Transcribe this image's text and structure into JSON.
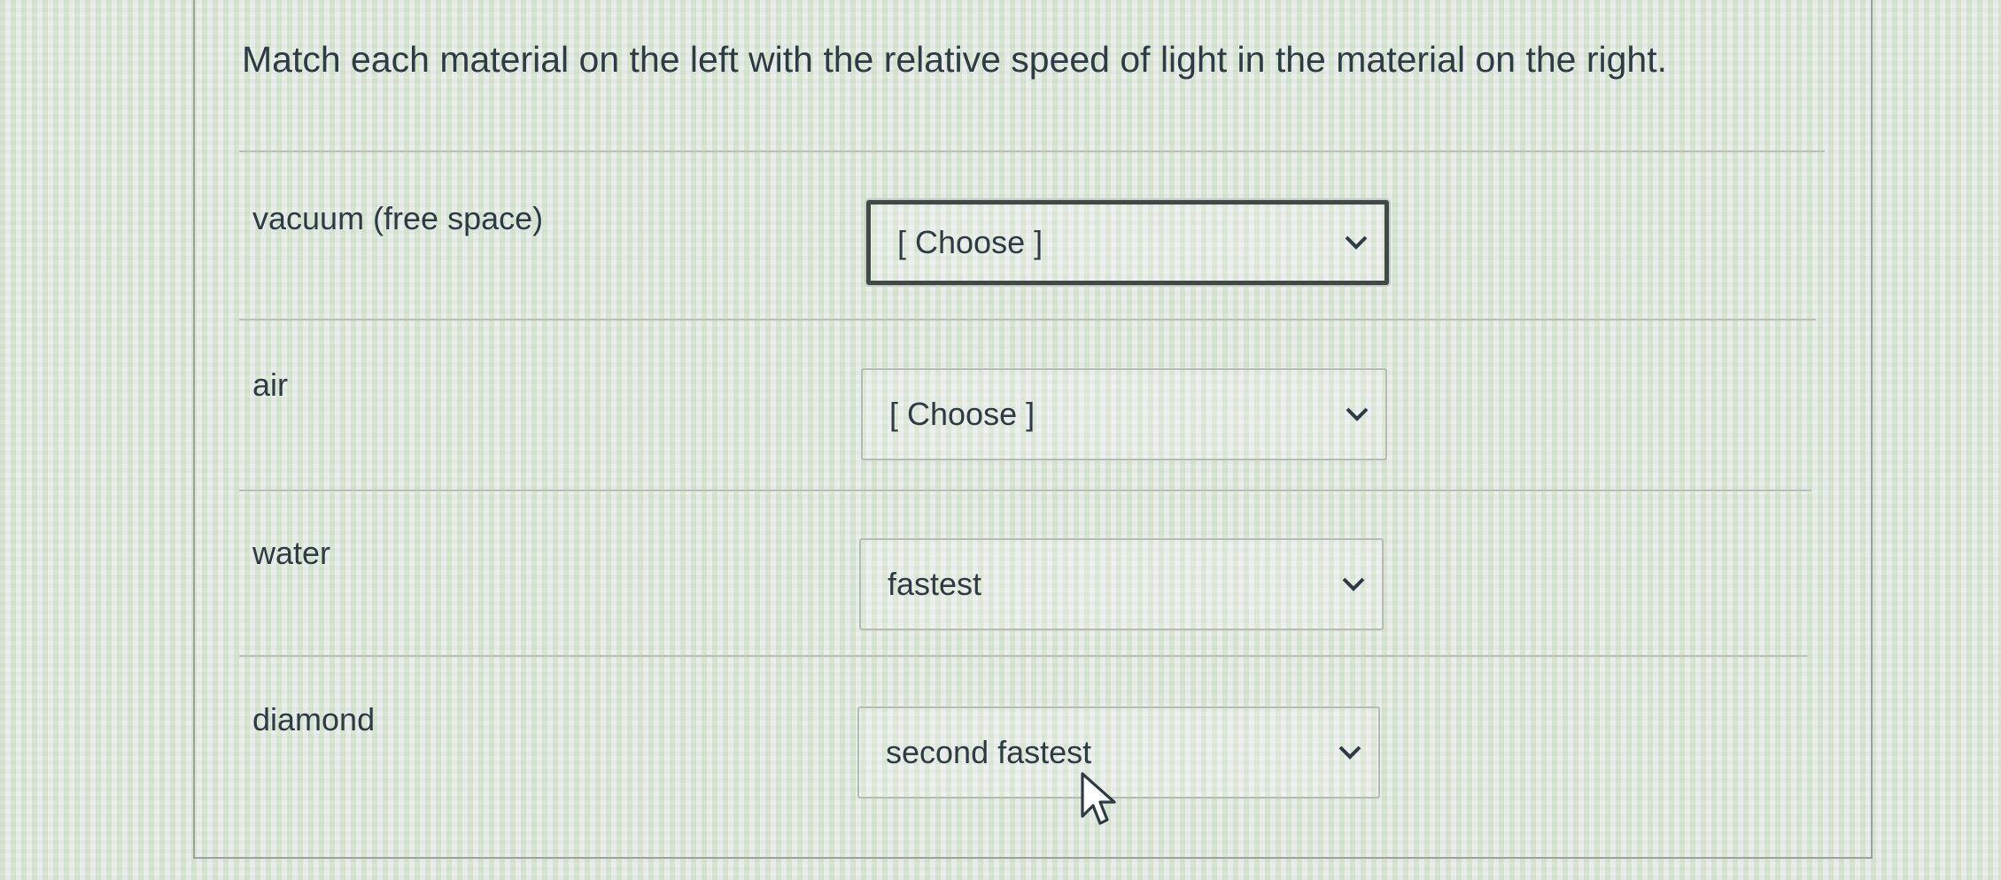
{
  "question": "Match each material on the left with the relative speed of light in the material on the right.",
  "rows": [
    {
      "material": "vacuum (free space)",
      "selected": "[ Choose ]"
    },
    {
      "material": "air",
      "selected": "[ Choose ]"
    },
    {
      "material": "water",
      "selected": "fastest"
    },
    {
      "material": "diamond",
      "selected": "second fastest"
    }
  ],
  "icons": {
    "dropdown": "chevron-down-icon",
    "pointer": "mouse-pointer-icon"
  },
  "colors": {
    "text": "#2d3b45",
    "focus_border": "#3d4a45",
    "select_border": "#b4bcb4"
  }
}
